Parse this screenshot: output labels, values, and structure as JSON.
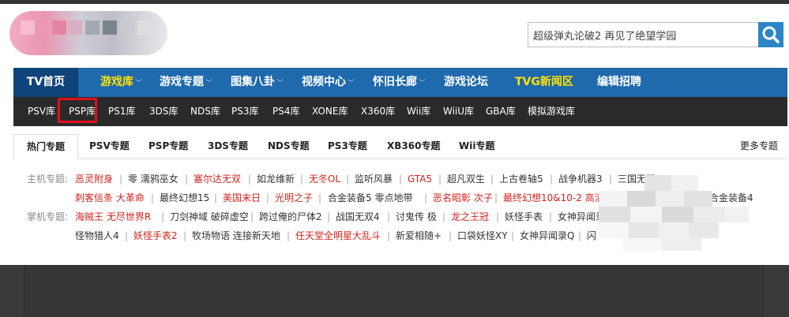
{
  "search": {
    "value": "超级弹丸论破2 再见了绝望学园"
  },
  "main_nav": [
    {
      "label": "TV首页",
      "color": "white",
      "active": true
    },
    {
      "label": "游戏库",
      "color": "yellow",
      "dropdown": true
    },
    {
      "label": "游戏专题",
      "color": "white",
      "dropdown": true
    },
    {
      "label": "图集八卦",
      "color": "white",
      "dropdown": true
    },
    {
      "label": "视频中心",
      "color": "white",
      "dropdown": true
    },
    {
      "label": "怀旧长廊",
      "color": "white",
      "dropdown": true
    },
    {
      "label": "游戏论坛",
      "color": "white",
      "dropdown": false
    },
    {
      "label": "TVG新闻区",
      "color": "yellow",
      "dropdown": false
    },
    {
      "label": "编辑招聘",
      "color": "white",
      "dropdown": false
    }
  ],
  "sub_nav": [
    "PSV库",
    "PSP库",
    "PS1库",
    "3DS库",
    "NDS库",
    "PS3库",
    "PS4库",
    "XONE库",
    "X360库",
    "Wii库",
    "WiiU库",
    "GBA库",
    "模拟游戏库"
  ],
  "sub_nav_highlighted": "PSP库",
  "tabs": [
    "热门专题",
    "PSV专题",
    "PSP专题",
    "3DS专题",
    "NDS专题",
    "PS3专题",
    "XB360专题",
    "Wii专题"
  ],
  "more_link": "更多专题",
  "topics": {
    "console_label": "主机专题:",
    "handheld_label": "掌机专题:",
    "row1": [
      {
        "text": "恶灵附身",
        "red": true
      },
      {
        "text": "零 濡鸦巫女",
        "red": false
      },
      {
        "text": "塞尔达无双",
        "red": true
      },
      {
        "text": "如龙维新",
        "red": false
      },
      {
        "text": "无冬OL",
        "red": true
      },
      {
        "text": "监听风暴",
        "red": false
      },
      {
        "text": "GTA5",
        "red": true
      },
      {
        "text": "超凡双生",
        "red": false
      },
      {
        "text": "上古卷轴5",
        "red": false
      },
      {
        "text": "战争机器3",
        "red": false
      },
      {
        "text": "三国无双",
        "red": false
      }
    ],
    "row2": [
      {
        "text": "刺客信条 大革命",
        "red": true
      },
      {
        "text": "最终幻想15",
        "red": false
      },
      {
        "text": "美国末日",
        "red": true
      },
      {
        "text": "光明之子",
        "red": true
      },
      {
        "text": "合金装备5 零点地带",
        "red": false
      },
      {
        "text": "恶名昭彰 次子",
        "red": true
      },
      {
        "text": "最终幻想10&10-2 高清版",
        "red": true
      },
      {
        "text": "合金装备4",
        "red": false
      }
    ],
    "row3": [
      {
        "text": "海贼王 无尽世界R",
        "red": true
      },
      {
        "text": "刀剑神域 破碎虚空",
        "red": false
      },
      {
        "text": "跨过俺的尸体2",
        "red": false
      },
      {
        "text": "战国无双4",
        "red": false
      },
      {
        "text": "讨鬼传 极",
        "red": false
      },
      {
        "text": "龙之王冠",
        "red": true
      },
      {
        "text": "妖怪手表",
        "red": false
      },
      {
        "text": "女神异闻录",
        "red": false
      }
    ],
    "row4": [
      {
        "text": "怪物猎人4",
        "red": false
      },
      {
        "text": "妖怪手表2",
        "red": true
      },
      {
        "text": "牧场物语 连接新天地",
        "red": false
      },
      {
        "text": "任天堂全明星大乱斗",
        "red": true
      },
      {
        "text": "新爱相随+",
        "red": false
      },
      {
        "text": "口袋妖怪XY",
        "red": false
      },
      {
        "text": "女神异闻录Q",
        "red": false
      },
      {
        "text": "闪",
        "red": false
      }
    ]
  },
  "colors": {
    "nav_blue": "#1f69ad",
    "nav_active": "#0e4479",
    "subnav_bg": "#2a2a2a",
    "highlight_red": "#e1101e",
    "search_blue": "#2b86c7",
    "topic_red": "#d0241c"
  }
}
